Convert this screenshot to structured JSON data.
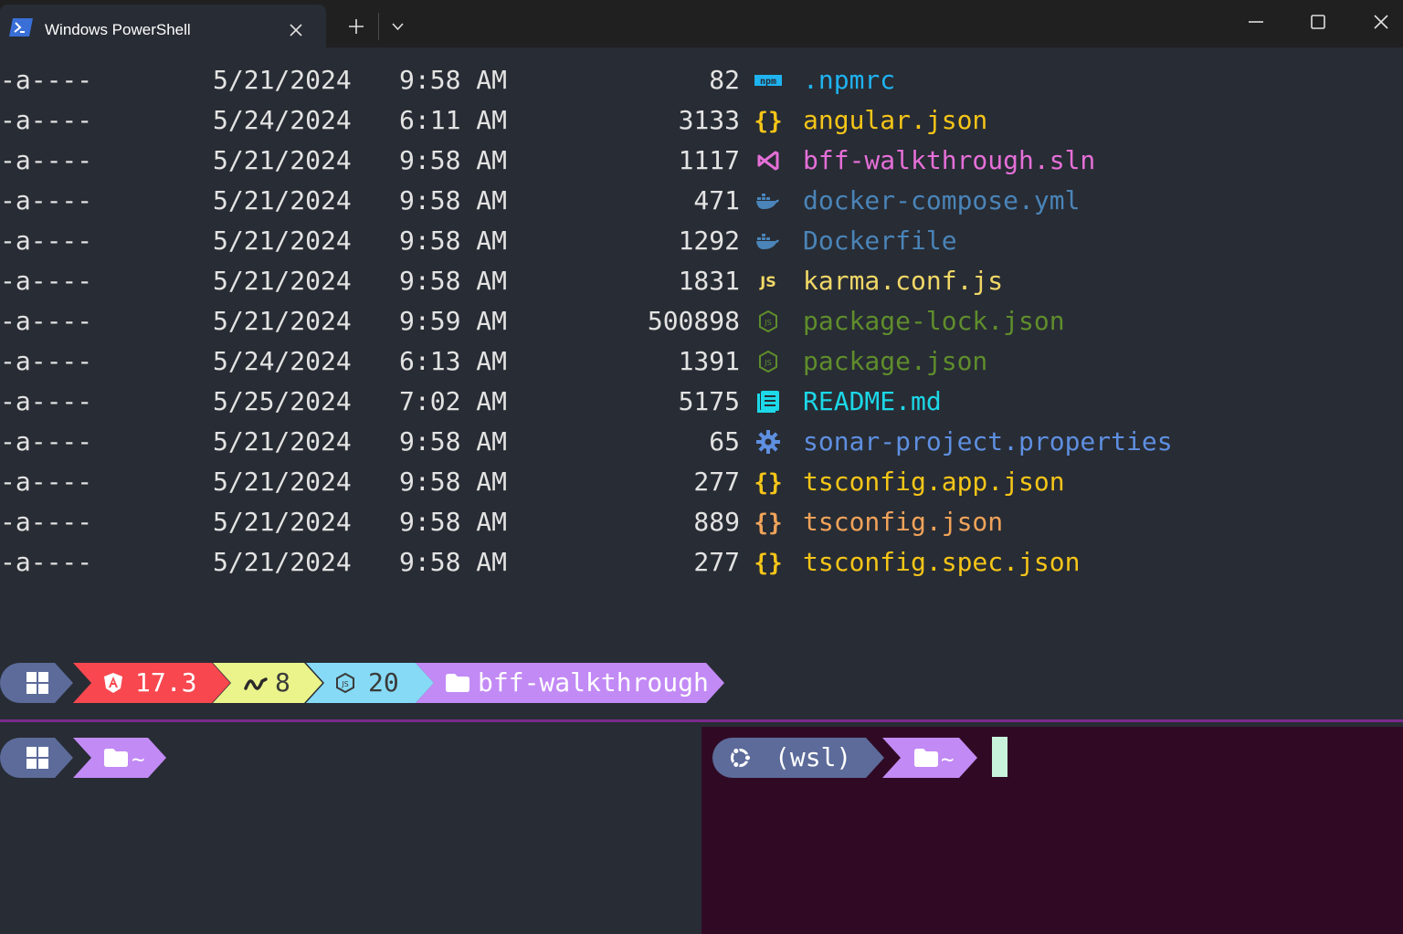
{
  "window": {
    "tab_title": "Windows PowerShell",
    "icons": [
      "powershell-icon",
      "close-icon",
      "plus-icon",
      "chevron-down-icon",
      "minimize-icon",
      "maximize-icon",
      "window-close-icon"
    ]
  },
  "listing": [
    {
      "mode": "-a----",
      "date": "5/21/2024",
      "time": "9:58 AM",
      "size": "82",
      "name": ".npmrc",
      "icon": "npm-icon",
      "color": "#1fb3f0"
    },
    {
      "mode": "-a----",
      "date": "5/24/2024",
      "time": "6:11 AM",
      "size": "3133",
      "name": "angular.json",
      "icon": "json-braces-icon",
      "color": "#f5c518"
    },
    {
      "mode": "-a----",
      "date": "5/21/2024",
      "time": "9:58 AM",
      "size": "1117",
      "name": "bff-walkthrough.sln",
      "icon": "visual-studio-icon",
      "color": "#e56fd8"
    },
    {
      "mode": "-a----",
      "date": "5/21/2024",
      "time": "9:58 AM",
      "size": "471",
      "name": "docker-compose.yml",
      "icon": "docker-icon",
      "color": "#4a84b8"
    },
    {
      "mode": "-a----",
      "date": "5/21/2024",
      "time": "9:58 AM",
      "size": "1292",
      "name": "Dockerfile",
      "icon": "docker-icon",
      "color": "#4a84b8"
    },
    {
      "mode": "-a----",
      "date": "5/21/2024",
      "time": "9:58 AM",
      "size": "1831",
      "name": "karma.conf.js",
      "icon": "javascript-icon",
      "color": "#f0d867"
    },
    {
      "mode": "-a----",
      "date": "5/21/2024",
      "time": "9:59 AM",
      "size": "500898",
      "name": "package-lock.json",
      "icon": "nodejs-icon",
      "color": "#5f8d2c"
    },
    {
      "mode": "-a----",
      "date": "5/24/2024",
      "time": "6:13 AM",
      "size": "1391",
      "name": "package.json",
      "icon": "nodejs-icon",
      "color": "#5f8d2c"
    },
    {
      "mode": "-a----",
      "date": "5/25/2024",
      "time": "7:02 AM",
      "size": "5175",
      "name": "README.md",
      "icon": "markdown-book-icon",
      "color": "#1cd8e8"
    },
    {
      "mode": "-a----",
      "date": "5/21/2024",
      "time": "9:58 AM",
      "size": "65",
      "name": "sonar-project.properties",
      "icon": "gear-icon",
      "color": "#5e8fe0"
    },
    {
      "mode": "-a----",
      "date": "5/21/2024",
      "time": "9:58 AM",
      "size": "277",
      "name": "tsconfig.app.json",
      "icon": "json-braces-icon",
      "color": "#f5c518"
    },
    {
      "mode": "-a----",
      "date": "5/21/2024",
      "time": "9:58 AM",
      "size": "889",
      "name": "tsconfig.json",
      "icon": "json-braces-icon",
      "color": "#f0a35a"
    },
    {
      "mode": "-a----",
      "date": "5/21/2024",
      "time": "9:58 AM",
      "size": "277",
      "name": "tsconfig.spec.json",
      "icon": "json-braces-icon",
      "color": "#f5c518"
    }
  ],
  "prompt_main": {
    "segments": [
      {
        "icon": "windows-logo-icon",
        "text": "",
        "bg": "#5c6b9a",
        "fg": "#ffffff"
      },
      {
        "icon": "angular-icon",
        "text": "17.3",
        "bg": "#f8474f",
        "fg": "#ffffff"
      },
      {
        "icon": "pnpm-icon",
        "text": "8",
        "bg": "#eaf48a",
        "fg": "#3a3a3a"
      },
      {
        "icon": "nodejs-icon",
        "text": "20",
        "bg": "#86daf5",
        "fg": "#3a3a3a"
      },
      {
        "icon": "folder-icon",
        "text": "bff-walkthrough",
        "bg": "#c28af5",
        "fg": "#ffffff"
      }
    ]
  },
  "prompt_left": {
    "segments": [
      {
        "icon": "windows-logo-icon",
        "text": "",
        "bg": "#5c6b9a"
      },
      {
        "icon": "folder-icon",
        "text": "~",
        "bg": "#c28af5"
      }
    ]
  },
  "prompt_right": {
    "segments": [
      {
        "icon": "ubuntu-icon",
        "text": "(wsl)",
        "bg": "#5c6b9a"
      },
      {
        "icon": "folder-icon",
        "text": "~",
        "bg": "#c28af5"
      }
    ]
  },
  "colors": {
    "terminal_bg": "#282c34",
    "wsl_pane_bg": "#300a24",
    "pane_divider": "#7a2a8c",
    "cursor": "#c8f2dc",
    "text": "#e3e3e3"
  }
}
